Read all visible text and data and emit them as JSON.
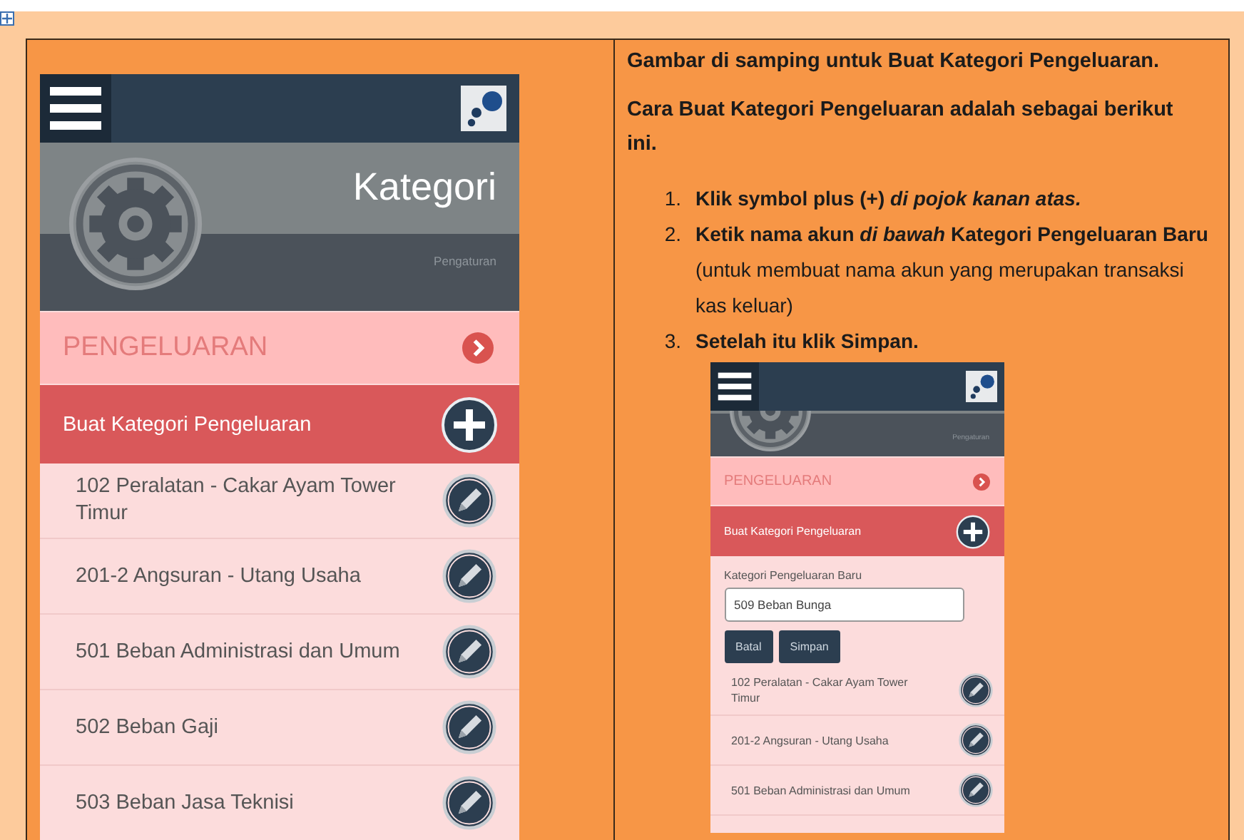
{
  "app_screen": {
    "title": "Kategori",
    "subtitle": "Pengaturan",
    "section": "PENGELUARAN",
    "create_label": "Buat Kategori Pengeluaran",
    "categories": [
      {
        "name": "102 Peralatan - Cakar Ayam Tower Timur"
      },
      {
        "name": "201-2 Angsuran - Utang Usaha"
      },
      {
        "name": "501 Beban Administrasi dan Umum"
      },
      {
        "name": "502 Beban Gaji"
      },
      {
        "name": "503 Beban Jasa Teknisi"
      }
    ]
  },
  "instructions": {
    "paragraphs": [
      "Gambar di samping  untuk Buat Kategori Pengeluaran.",
      "Cara Buat Kategori Pengeluaran adalah sebagai berikut ini."
    ],
    "steps": [
      {
        "number": "1.",
        "bold": true,
        "text": "Klik symbol plus (+) *di pojok kanan atas.*"
      },
      {
        "number": "2.",
        "bold": false,
        "text": "**Ketik nama akun** *di bawah* **Kategori Pengeluaran Baru** (untuk membuat nama akun yang merupakan transaksi kas keluar)"
      },
      {
        "number": "3.",
        "bold": true,
        "text": "Setelah itu klik Simpan."
      }
    ]
  },
  "preview_screen": {
    "subtitle": "Pengaturan",
    "section": "PENGELUARAN",
    "create_label": "Buat Kategori Pengeluaran",
    "form": {
      "label": "Kategori Pengeluaran Baru",
      "value": "509 Beban Bunga",
      "buttons": [
        "Batal",
        "Simpan"
      ]
    },
    "categories": [
      {
        "name": "102 Peralatan - Cakar Ayam Tower Timur"
      },
      {
        "name": "201-2 Angsuran - Utang Usaha"
      },
      {
        "name": "501 Beban Administrasi dan Umum"
      }
    ]
  }
}
